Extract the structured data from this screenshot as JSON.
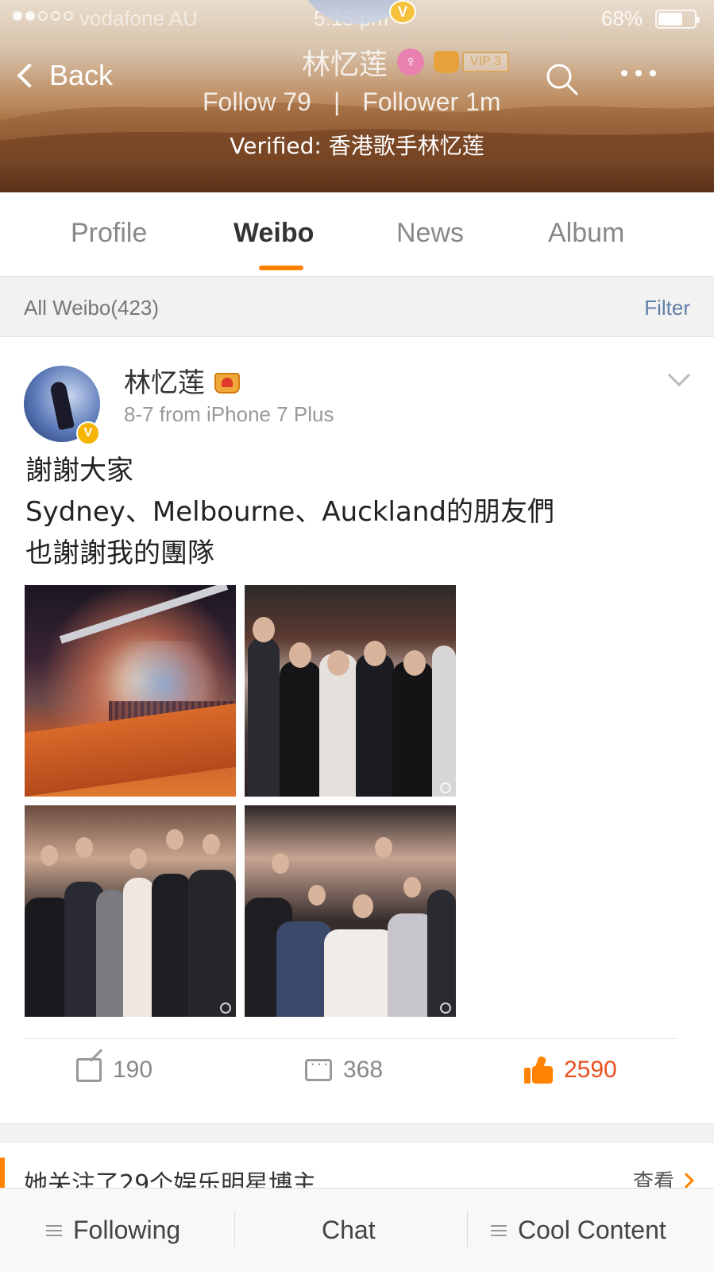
{
  "status_bar": {
    "carrier": "vodafone AU",
    "time": "5:15 pm",
    "battery": "68%",
    "battery_level": 0.68
  },
  "header": {
    "back_label": "Back",
    "name": "林忆莲",
    "vip_label": "VIP 3",
    "follow_label": "Follow",
    "follow_count": "79",
    "separator": "|",
    "follower_label": "Follower",
    "follower_count": "1m",
    "verified": "Verified: 香港歌手林忆莲"
  },
  "tabs": [
    {
      "label": "Profile"
    },
    {
      "label": "Weibo"
    },
    {
      "label": "News"
    },
    {
      "label": "Album"
    }
  ],
  "filter_bar": {
    "all_weibo": "All Weibo(423)",
    "filter_label": "Filter"
  },
  "post": {
    "author": "林忆莲",
    "meta": "8-7  from iPhone 7 Plus",
    "text_lines": [
      "謝謝大家",
      "Sydney、Melbourne、Auckland的朋友們",
      "也謝謝我的團隊"
    ],
    "repost_count": "190",
    "comment_count": "368",
    "like_count": "2590"
  },
  "recommendation": {
    "text": "她关注了29个娱乐明星博主",
    "link": "查看"
  },
  "toolbar": {
    "following": "Following",
    "chat": "Chat",
    "cool_content": "Cool Content"
  },
  "colors": {
    "accent": "#ff8200",
    "like": "#e8501e",
    "link": "#5e7fa8"
  }
}
